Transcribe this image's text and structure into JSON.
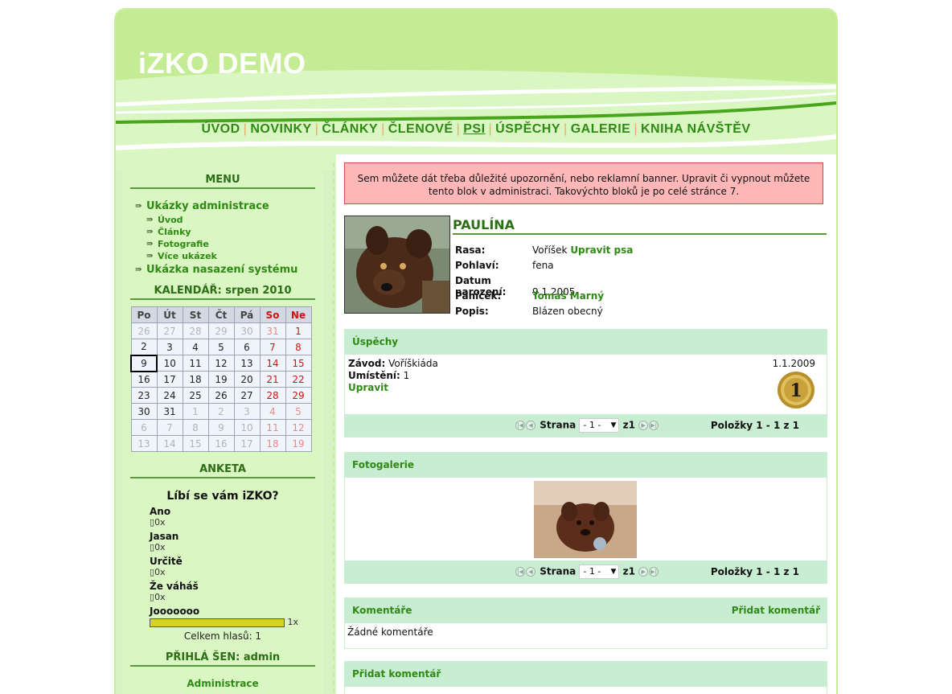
{
  "site": {
    "title": "iZKO DEMO"
  },
  "nav": {
    "items": [
      "ÚVOD",
      "NOVINKY",
      "ČLÁNKY",
      "ČLENOVÉ",
      "PSI",
      "ÚSPĚCHY",
      "GALERIE",
      "KNIHA NÁVŠTĚV"
    ],
    "active": "PSI"
  },
  "sidebar": {
    "menu_heading": "MENU",
    "menu": [
      {
        "label": "Ukázky administrace",
        "children": [
          "Úvod",
          "Články",
          "Fotografie",
          "Více ukázek"
        ]
      },
      {
        "label": "Ukázka nasazení systému",
        "children": []
      }
    ],
    "calendar_heading": "KALENDÁŘ: srpen 2010",
    "calendar": {
      "days": [
        "Po",
        "Út",
        "St",
        "Čt",
        "Pá",
        "So",
        "Ne"
      ],
      "weeks": [
        [
          "26",
          "27",
          "28",
          "29",
          "30",
          "31",
          "1"
        ],
        [
          "2",
          "3",
          "4",
          "5",
          "6",
          "7",
          "8"
        ],
        [
          "9",
          "10",
          "11",
          "12",
          "13",
          "14",
          "15"
        ],
        [
          "16",
          "17",
          "18",
          "19",
          "20",
          "21",
          "22"
        ],
        [
          "23",
          "24",
          "25",
          "26",
          "27",
          "28",
          "29"
        ],
        [
          "30",
          "31",
          "1",
          "2",
          "3",
          "4",
          "5"
        ],
        [
          "6",
          "7",
          "8",
          "9",
          "10",
          "11",
          "12"
        ],
        [
          "13",
          "14",
          "15",
          "16",
          "17",
          "18",
          "19"
        ]
      ],
      "today": "9"
    },
    "poll_heading": "ANKETA",
    "poll": {
      "question": "Líbí se vám iZKO?",
      "options": [
        {
          "label": "Ano",
          "count": "0x"
        },
        {
          "label": "Jasan",
          "count": "0x"
        },
        {
          "label": "Určitě",
          "count": "0x"
        },
        {
          "label": "Že váháš",
          "count": "0x"
        },
        {
          "label": "Jooooooo",
          "count": "1x",
          "fraction": 1.0
        }
      ],
      "total": "Celkem hlasů: 1"
    },
    "login_heading": "PŘIHLÁ ŠEN: admin",
    "admin_link": "Administrace"
  },
  "main": {
    "notice": "Sem můžete dát třeba důležité upozornění, nebo reklamní banner. Upravit či vypnout můžete tento blok v administraci. Takovýchto bloků je po celé stránce 7.",
    "dog": {
      "name": "PAULÍNA",
      "fields": [
        {
          "key": "Rasa:",
          "value": "Voříšek",
          "link": "Upravit psa"
        },
        {
          "key": "Pohlaví:",
          "value": "fena",
          "link": ""
        },
        {
          "key": "Datum narození:",
          "value": "9.1.2005",
          "link": ""
        },
        {
          "key": "Páníček:",
          "value": "",
          "link": "Tomáš Marný"
        },
        {
          "key": "Popis:",
          "value": "Blázen obecný",
          "link": ""
        }
      ]
    },
    "achievements": {
      "title": "Úspěchy",
      "race_label": "Závod:",
      "race": "Voříškiáda",
      "place_label": "Umístění:",
      "place": "1",
      "edit": "Upravit",
      "date": "1.1.2009",
      "medal": "1"
    },
    "pager": {
      "page_label": "Strana",
      "page_value": "- 1 -",
      "of": "z",
      "total_pages": "1",
      "items_label": "Položky",
      "items_range": "1 - 1 z 1"
    },
    "gallery": {
      "title": "Fotogalerie"
    },
    "comments": {
      "title": "Komentáře",
      "add": "Přidat komentář",
      "empty": "Žádné komentáře"
    },
    "add_comment": {
      "title": "Přidat komentář"
    }
  }
}
